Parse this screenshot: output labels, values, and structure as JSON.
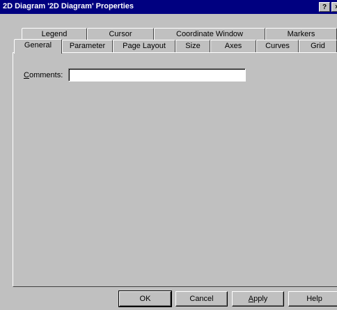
{
  "window": {
    "title": "2D Diagram '2D Diagram' Properties",
    "help_glyph": "?",
    "close_glyph": "×"
  },
  "tabs_row1": [
    {
      "label": "Legend"
    },
    {
      "label": "Cursor"
    },
    {
      "label": "Coordinate Window"
    },
    {
      "label": "Markers"
    }
  ],
  "tabs_row2": [
    {
      "label": "General"
    },
    {
      "label": "Parameter"
    },
    {
      "label": "Page Layout"
    },
    {
      "label": "Size"
    },
    {
      "label": "Axes"
    },
    {
      "label": "Curves"
    },
    {
      "label": "Grid"
    }
  ],
  "active_tab": "General",
  "general": {
    "comments_label_mnemonic": "C",
    "comments_label_rest": "omments:",
    "comments_value": ""
  },
  "buttons": {
    "ok": "OK",
    "cancel": "Cancel",
    "apply_mnemonic": "A",
    "apply_rest": "pply",
    "help": "Help"
  }
}
